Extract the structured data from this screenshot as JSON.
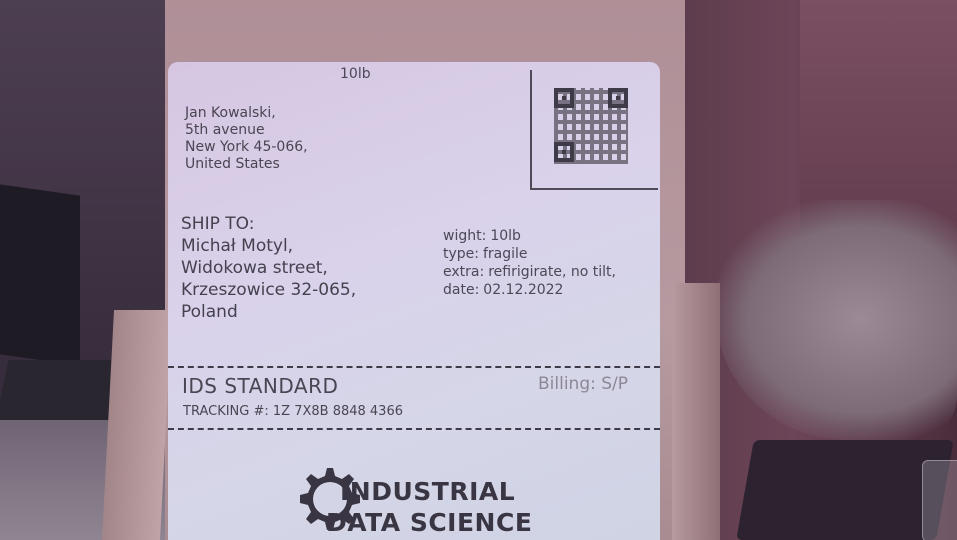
{
  "label": {
    "weight_top": "10lb",
    "sender_name": "Jan Kowalski,",
    "sender_street": "5th avenue",
    "sender_city": "New York 45-066,",
    "sender_country": "United States",
    "ship_to_heading": "SHIP TO:",
    "recipient_name": "Michał Motyl,",
    "recipient_street": "Widokowa street,",
    "recipient_city": "Krzeszowice 32-065,",
    "recipient_country": "Poland",
    "info": [
      {
        "key": "wight:",
        "value": "10lb"
      },
      {
        "key": "type:",
        "value": "fragile"
      },
      {
        "key": "extra:",
        "value": "refirigirate, no tilt,"
      },
      {
        "key": "date:",
        "value": "02.12.2022"
      }
    ],
    "service": "IDS STANDARD",
    "billing": "Billing: S/P",
    "tracking": "TRACKING #: 1Z 7X8B 8848 4366",
    "brand_line1": "INDUSTRIAL",
    "brand_line2": "DATA SCIENCE"
  },
  "colors": {
    "label_paper": "#d6d2e8",
    "ink": "#46414f",
    "box_cardboard": "#b69aa0"
  }
}
